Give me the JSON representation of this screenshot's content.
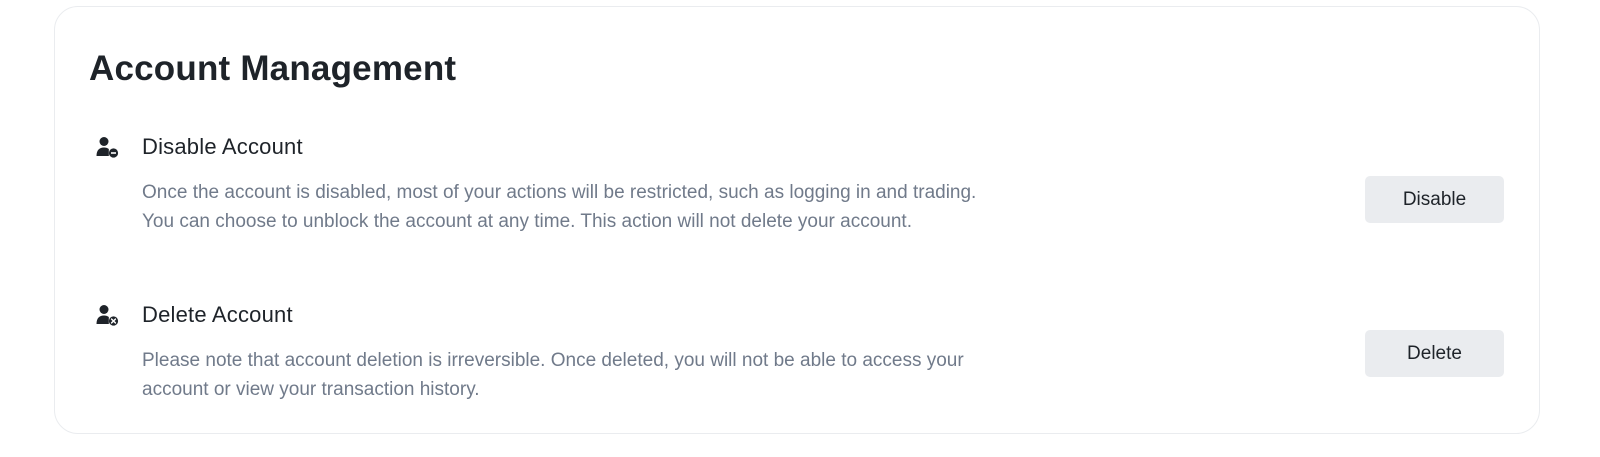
{
  "account_management": {
    "title": "Account Management",
    "disable": {
      "icon": "user-minus-icon",
      "title": "Disable Account",
      "description": "Once the account is disabled, most of your actions will be restricted, such as logging in and trading. You can choose to unblock the account at any time. This action will not delete your account.",
      "button_label": "Disable"
    },
    "delete": {
      "icon": "user-delete-icon",
      "title": "Delete Account",
      "description": "Please note that account deletion is irreversible. Once deleted, you will not be able to access your account or view your transaction history.",
      "button_label": "Delete"
    }
  },
  "colors": {
    "text_primary": "#1e2329",
    "text_secondary": "#707a8a",
    "button_bg": "#eaecef",
    "card_border": "#eaecef"
  }
}
